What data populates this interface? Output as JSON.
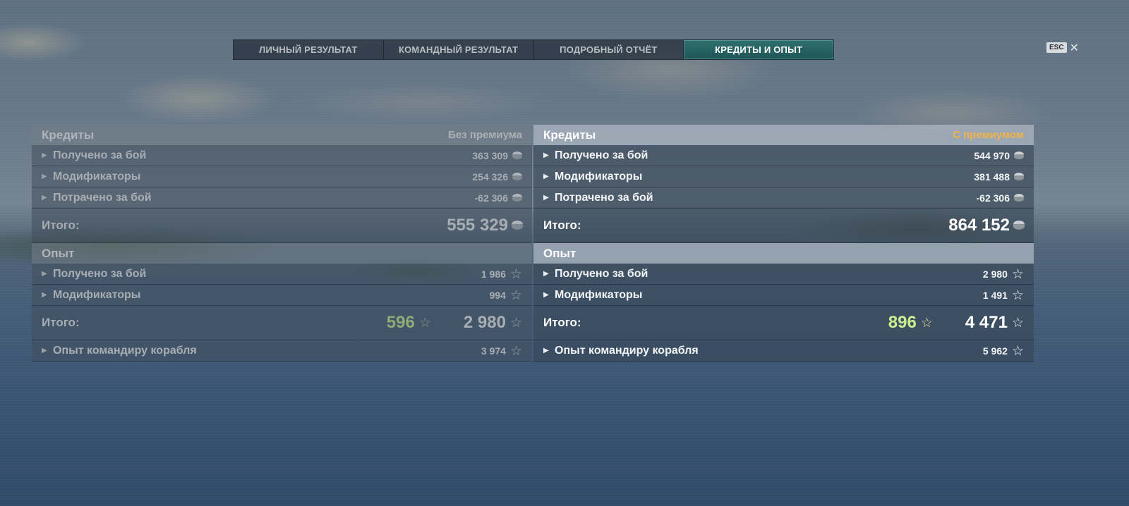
{
  "tabs": [
    {
      "label": "ЛИЧНЫЙ РЕЗУЛЬТАТ"
    },
    {
      "label": "КОМАНДНЫЙ РЕЗУЛЬТАТ"
    },
    {
      "label": "ПОДРОБНЫЙ ОТЧЁТ"
    },
    {
      "label": "КРЕДИТЫ И ОПЫТ",
      "active": true
    }
  ],
  "close": {
    "key": "ESC",
    "icon": "close-icon",
    "glyph": "✕"
  },
  "left": {
    "credits": {
      "title": "Кредиты",
      "subtitle": "Без премиума",
      "rows": [
        {
          "label": "Получено за бой",
          "value": "363 309"
        },
        {
          "label": "Модификаторы",
          "value": "254 326"
        },
        {
          "label": "Потрачено за бой",
          "value": "-62 306"
        }
      ],
      "total_label": "Итого:",
      "total_value": "555 329"
    },
    "xp": {
      "title": "Опыт",
      "rows": [
        {
          "label": "Получено за бой",
          "value": "1 986"
        },
        {
          "label": "Модификаторы",
          "value": "994"
        }
      ],
      "total_label": "Итого:",
      "bonus_value": "596",
      "total_value": "2 980"
    },
    "commander": {
      "label": "Опыт командиру корабля",
      "value": "3 974"
    }
  },
  "right": {
    "credits": {
      "title": "Кредиты",
      "subtitle": "С премиумом",
      "rows": [
        {
          "label": "Получено за бой",
          "value": "544 970"
        },
        {
          "label": "Модификаторы",
          "value": "381 488"
        },
        {
          "label": "Потрачено за бой",
          "value": "-62 306"
        }
      ],
      "total_label": "Итого:",
      "total_value": "864 152"
    },
    "xp": {
      "title": "Опыт",
      "rows": [
        {
          "label": "Получено за бой",
          "value": "2 980"
        },
        {
          "label": "Модификаторы",
          "value": "1 491"
        }
      ],
      "total_label": "Итого:",
      "bonus_value": "896",
      "total_value": "4 471"
    },
    "commander": {
      "label": "Опыт командиру корабля",
      "value": "5 962"
    }
  },
  "colors": {
    "premium_accent": "#f2b347",
    "active_tab": "#2f6f6f",
    "bonus_xp_left": "#8eab77",
    "bonus_xp_right": "#cdf08e"
  }
}
